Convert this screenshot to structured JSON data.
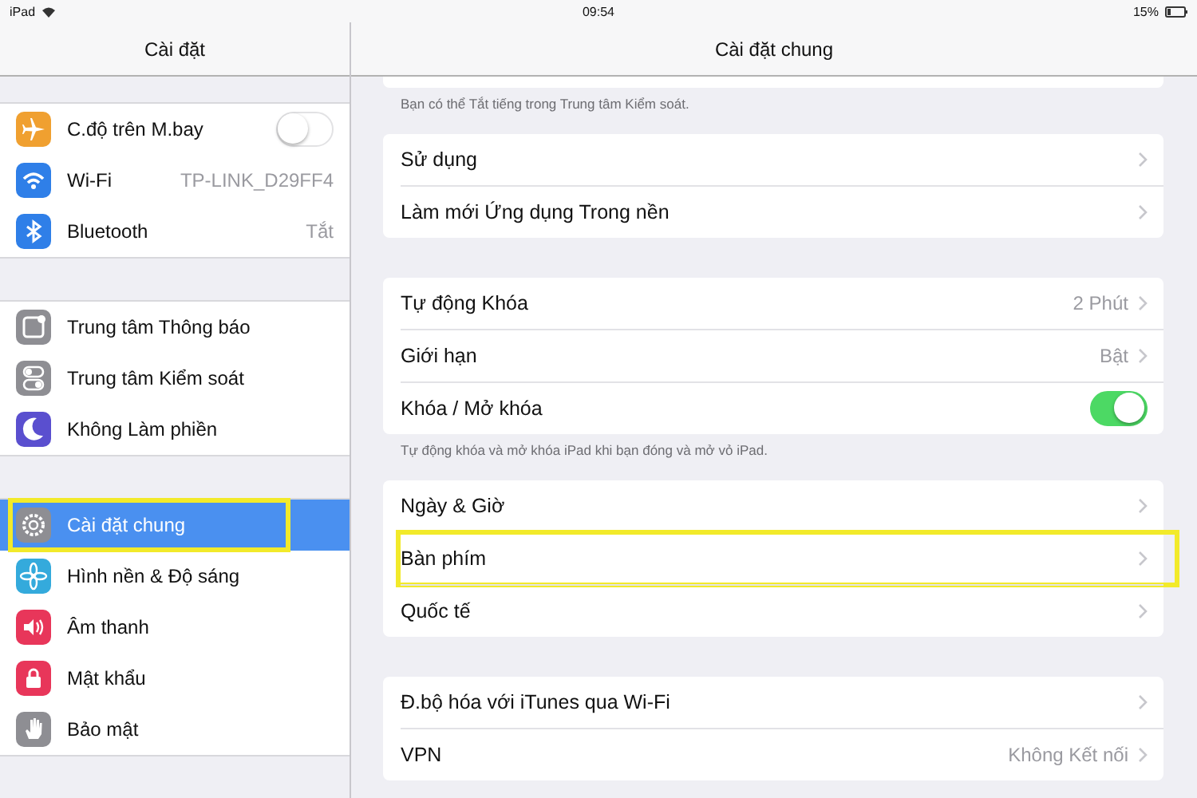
{
  "status_bar": {
    "device": "iPad",
    "time": "09:54",
    "battery": "15%"
  },
  "sidebar": {
    "title": "Cài đặt",
    "groups": [
      {
        "items": [
          {
            "label": "C.độ trên M.bay",
            "color": "#f0a030",
            "kind": "toggle",
            "on": false,
            "selected": false,
            "highlight": false
          },
          {
            "label": "Wi-Fi",
            "color": "#2f7fe8",
            "kind": "value",
            "value": "TP-LINK_D29FF4",
            "selected": false,
            "highlight": false
          },
          {
            "label": "Bluetooth",
            "color": "#2f7fe8",
            "kind": "value",
            "value": "Tắt",
            "selected": false,
            "highlight": false
          }
        ]
      },
      {
        "items": [
          {
            "label": "Trung tâm Thông báo",
            "color": "#8e8e93",
            "kind": "plain",
            "selected": false,
            "highlight": false
          },
          {
            "label": "Trung tâm Kiểm soát",
            "color": "#8e8e93",
            "kind": "plain",
            "selected": false,
            "highlight": false
          },
          {
            "label": "Không Làm phiền",
            "color": "#5a4fcf",
            "kind": "plain",
            "selected": false,
            "highlight": false
          }
        ]
      },
      {
        "items": [
          {
            "label": "Cài đặt chung",
            "color": "#8e8e93",
            "kind": "plain",
            "selected": true,
            "highlight": true
          },
          {
            "label": "Hình nền & Độ sáng",
            "color": "#34aadc",
            "kind": "plain",
            "selected": false,
            "highlight": false
          },
          {
            "label": "Âm thanh",
            "color": "#e8365a",
            "kind": "plain",
            "selected": false,
            "highlight": false
          },
          {
            "label": "Mật khẩu",
            "color": "#e8365a",
            "kind": "plain",
            "selected": false,
            "highlight": false
          },
          {
            "label": "Bảo mật",
            "color": "#8e8e93",
            "kind": "plain",
            "selected": false,
            "highlight": false
          }
        ]
      }
    ]
  },
  "detail": {
    "title": "Cài đặt chung",
    "groups": [
      {
        "footer": "Bạn có thể Tắt tiếng trong Trung tâm Kiểm soát."
      },
      {
        "rows": [
          {
            "label": "Sử dụng",
            "kind": "link",
            "highlight": false
          },
          {
            "label": "Làm mới Ứng dụng Trong nền",
            "kind": "link",
            "highlight": false
          }
        ]
      },
      {
        "rows": [
          {
            "label": "Tự động Khóa",
            "kind": "link",
            "value": "2 Phút",
            "highlight": false
          },
          {
            "label": "Giới hạn",
            "kind": "link",
            "value": "Bật",
            "highlight": false
          },
          {
            "label": "Khóa / Mở khóa",
            "kind": "toggle",
            "on": true,
            "highlight": false
          }
        ],
        "footer": "Tự động khóa và mở khóa iPad khi bạn đóng và mở vỏ iPad."
      },
      {
        "rows": [
          {
            "label": "Ngày & Giờ",
            "kind": "link",
            "highlight": false
          },
          {
            "label": "Bàn phím",
            "kind": "link",
            "highlight": true
          },
          {
            "label": "Quốc tế",
            "kind": "link",
            "highlight": false
          }
        ]
      },
      {
        "rows": [
          {
            "label": "Đ.bộ hóa với iTunes qua Wi-Fi",
            "kind": "link",
            "highlight": false
          },
          {
            "label": "VPN",
            "kind": "link",
            "value": "Không Kết nối",
            "highlight": false
          }
        ]
      }
    ]
  }
}
